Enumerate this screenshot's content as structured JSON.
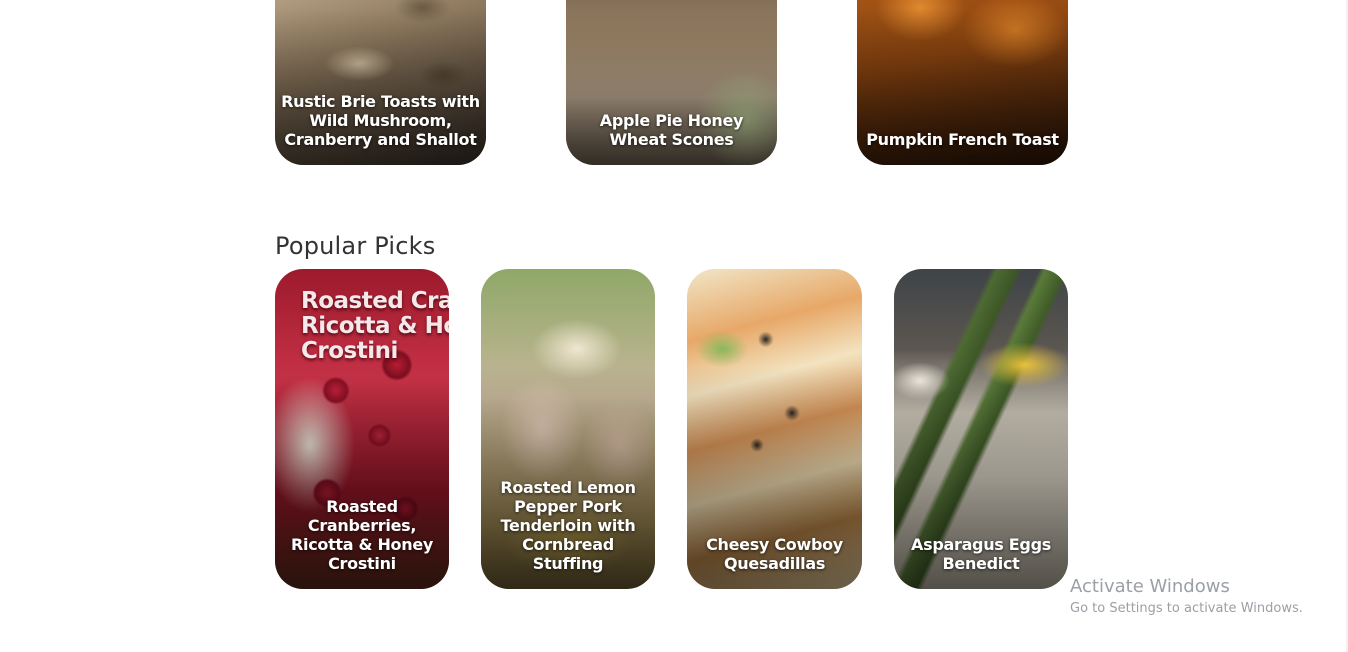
{
  "top_row": [
    {
      "label": "Rustic Brie Toasts with Wild Mushroom, Cranberry and Shallot",
      "icon": "brie-mushroom-photo"
    },
    {
      "label": "Apple Pie Honey Wheat Scones",
      "icon": "scone-photo"
    },
    {
      "label": "Pumpkin French Toast",
      "icon": "french-toast-photo"
    }
  ],
  "popular": {
    "title": "Popular Picks",
    "cards": [
      {
        "label": "Roasted Cranberries, Ricotta & Honey Crostini",
        "overlay": "Roasted Cran\nRicotta & Ho\nCrostini",
        "icon": "cranberry-crostini-photo"
      },
      {
        "label": "Roasted Lemon Pepper Pork Tenderloin with Cornbread Stuffing",
        "icon": "pork-tenderloin-photo"
      },
      {
        "label": "Cheesy Cowboy Quesadillas",
        "icon": "quesadilla-photo"
      },
      {
        "label": "Asparagus Eggs Benedict",
        "icon": "asparagus-benedict-photo"
      }
    ]
  },
  "windows_watermark": {
    "title": "Activate Windows",
    "subtitle": "Go to Settings to activate Windows."
  }
}
